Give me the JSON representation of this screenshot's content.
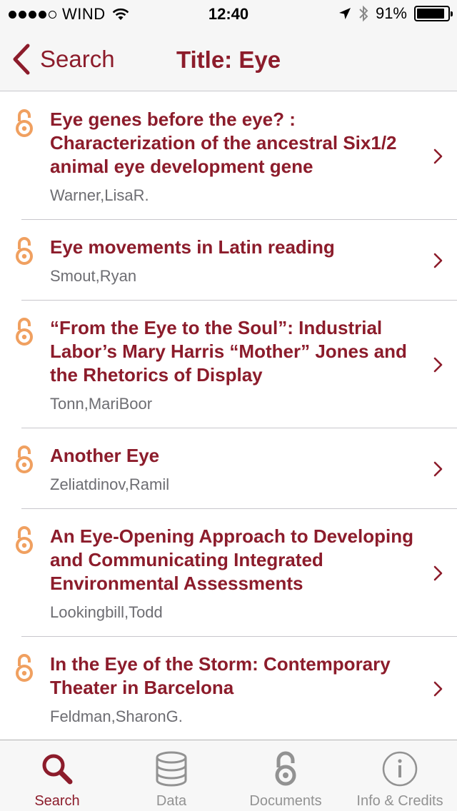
{
  "status_bar": {
    "carrier": "WIND",
    "time": "12:40",
    "battery": "91%",
    "battery_level": 0.91
  },
  "nav": {
    "back_label": "Search",
    "title": "Title: Eye"
  },
  "results": [
    {
      "title": "Eye genes before the eye? : Characterization of the ancestral Six1/2 animal eye development gene",
      "author": "Warner,LisaR."
    },
    {
      "title": "Eye movements in Latin reading",
      "author": "Smout,Ryan"
    },
    {
      "title": "“From the Eye to the Soul”: Industrial Labor’s Mary Harris “Mother” Jones and the Rhetorics of Display",
      "author": "Tonn,MariBoor"
    },
    {
      "title": "Another Eye",
      "author": "Zeliatdinov,Ramil"
    },
    {
      "title": "An Eye-Opening Approach to Developing and Communicating Integrated Environmental Assessments",
      "author": "Lookingbill,Todd"
    },
    {
      "title": "In the Eye of the Storm: Contemporary Theater in Barcelona",
      "author": "Feldman,SharonG."
    }
  ],
  "tabs": [
    {
      "label": "Search",
      "icon": "search-icon",
      "active": true
    },
    {
      "label": "Data",
      "icon": "database-icon",
      "active": false
    },
    {
      "label": "Documents",
      "icon": "open-access-icon",
      "active": false
    },
    {
      "label": "Info & Credits",
      "icon": "info-icon",
      "active": false
    }
  ],
  "colors": {
    "accent": "#8c1c2b",
    "open_access": "#f0a060",
    "tab_inactive": "#929292"
  }
}
